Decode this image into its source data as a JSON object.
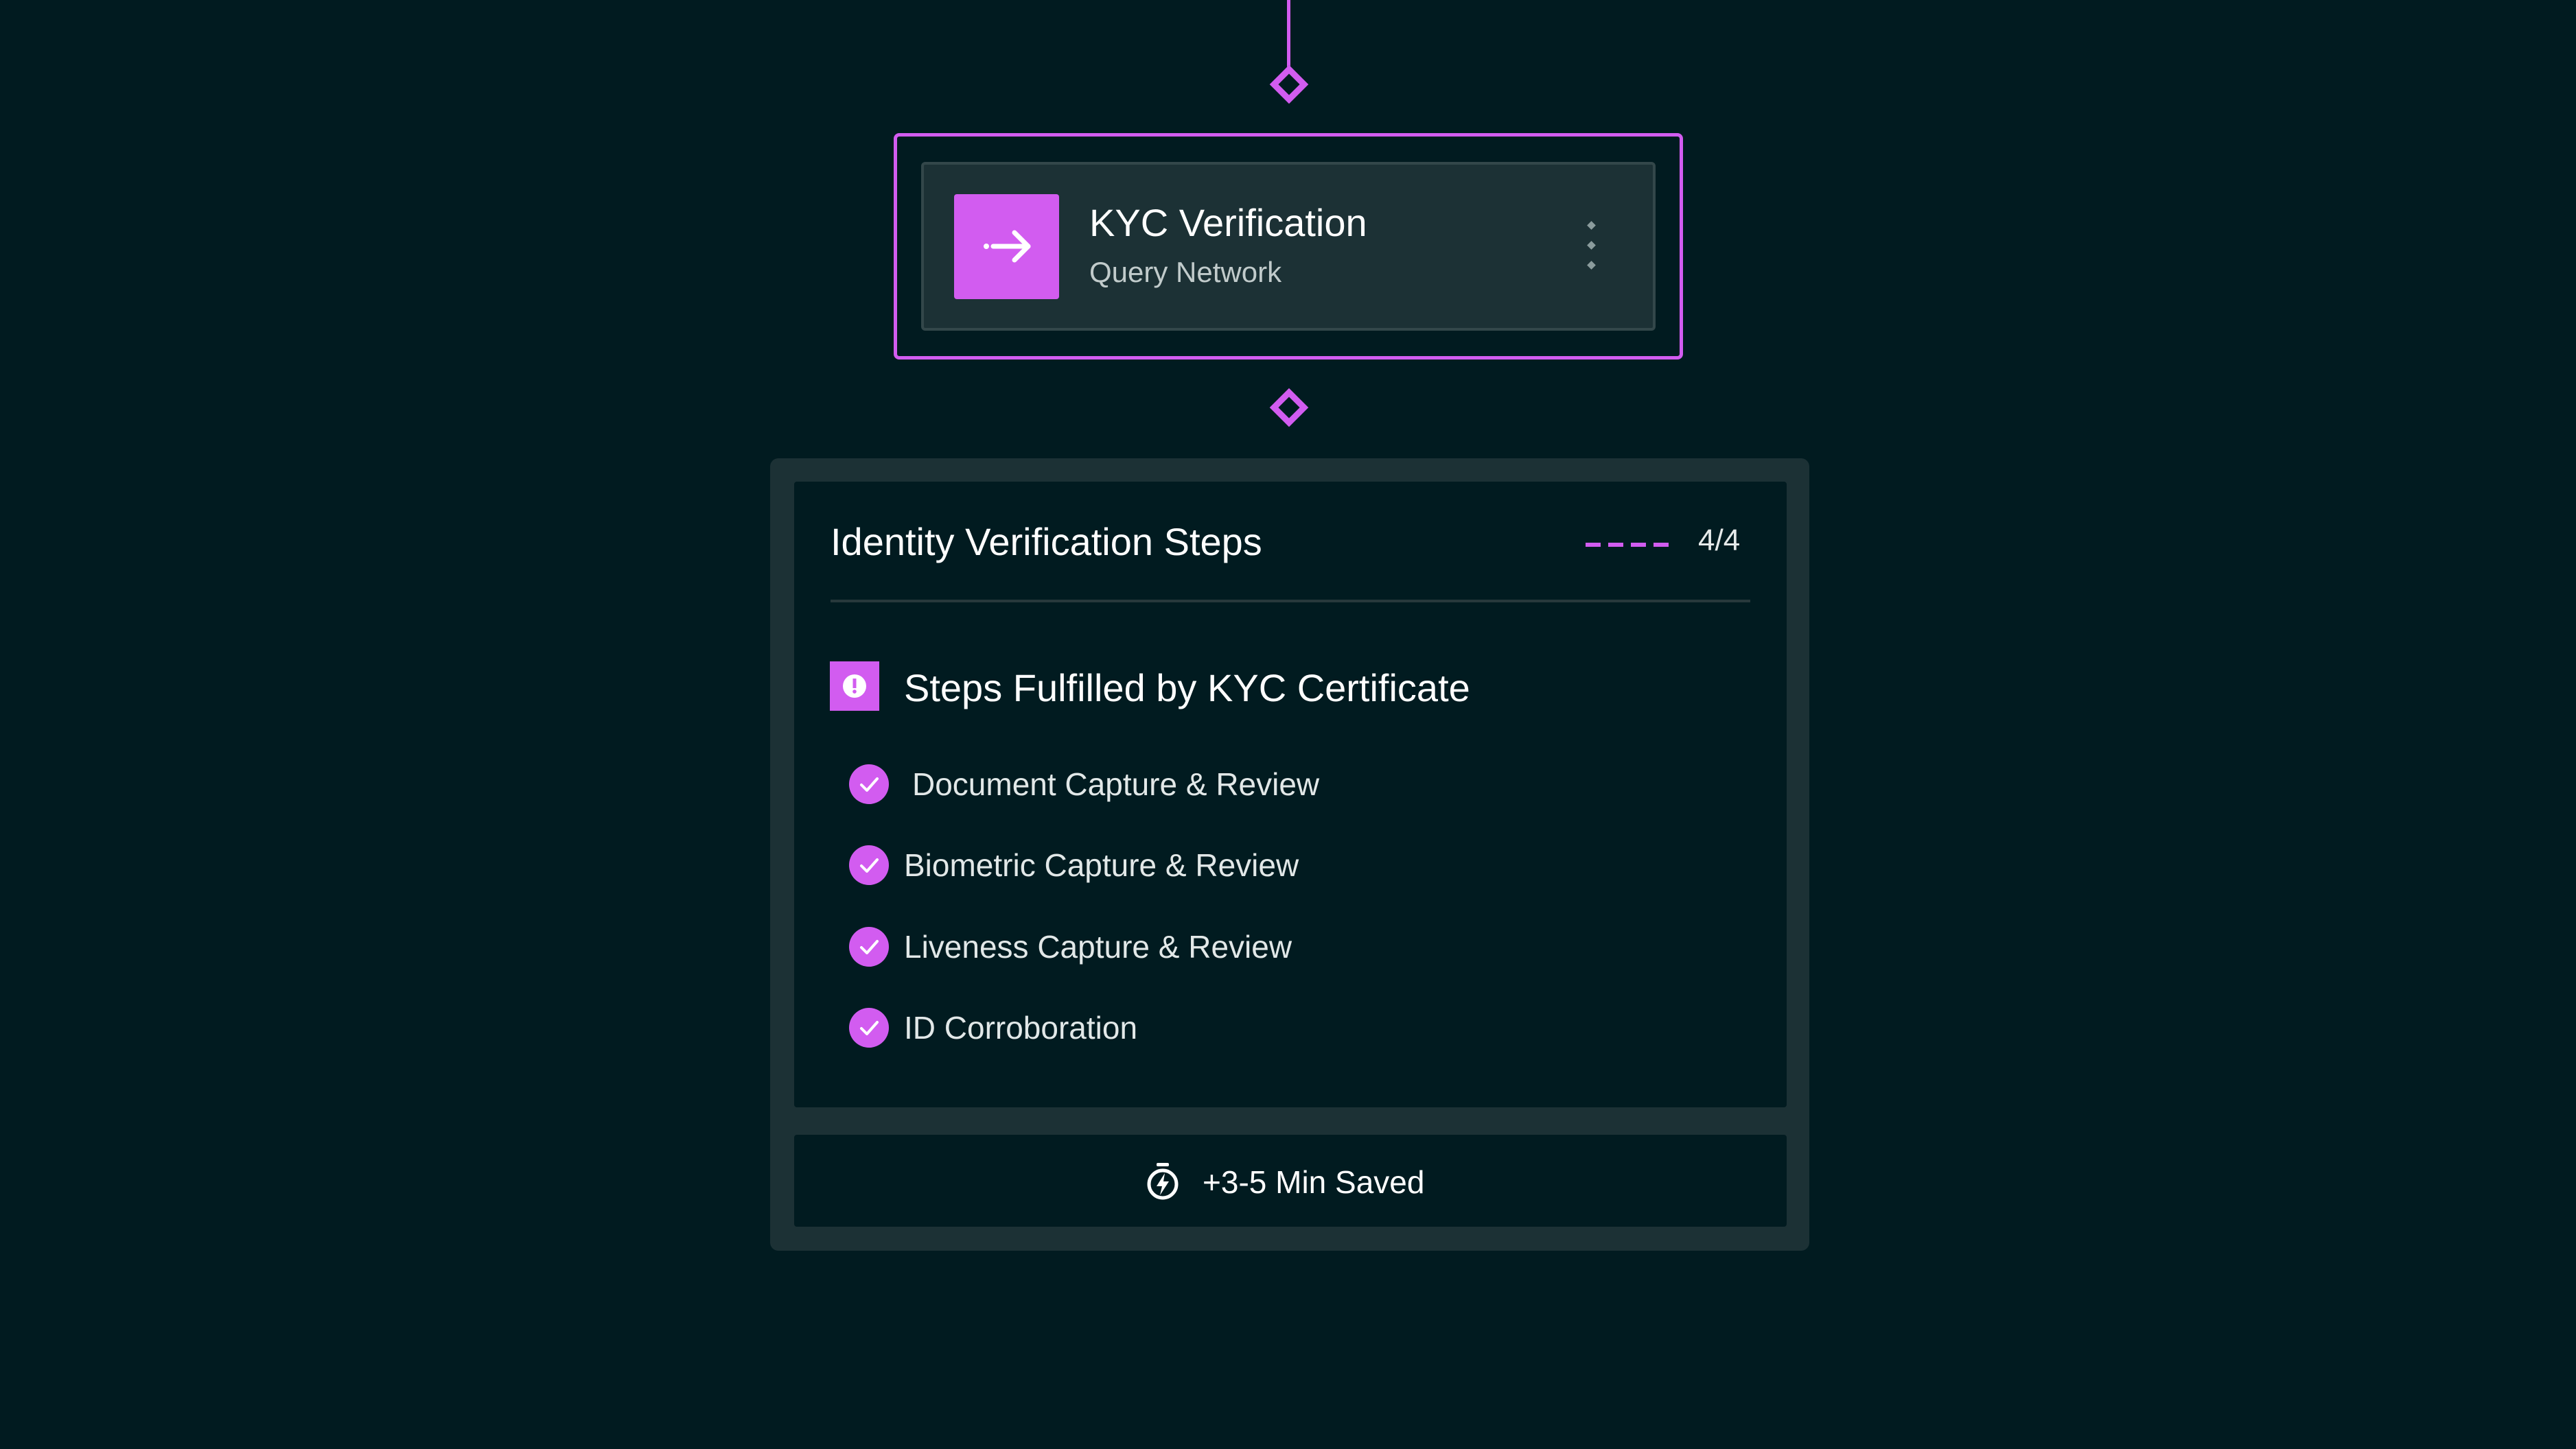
{
  "colors": {
    "background": "#011b20",
    "accent": "#d25cf0",
    "panel": "#1c3135",
    "text_primary": "#ffffff",
    "text_secondary": "#c1cbcb"
  },
  "node": {
    "title": "KYC Verification",
    "subtitle": "Query Network",
    "icon": "arrow-right-icon",
    "menu_icon": "more-vertical-icon"
  },
  "panel": {
    "title": "Identity Verification Steps",
    "progress": "4/4",
    "progress_fraction": 1.0,
    "certificate": {
      "icon": "alert-icon",
      "title": "Steps Fulfilled by KYC Certificate"
    },
    "steps": [
      {
        "label": "Document Capture & Review",
        "status": "complete"
      },
      {
        "label": "Biometric Capture & Review",
        "status": "complete"
      },
      {
        "label": "Liveness Capture & Review",
        "status": "complete"
      },
      {
        "label": "ID Corroboration",
        "status": "complete"
      }
    ],
    "time_saved": {
      "icon": "stopwatch-icon",
      "label": "+3-5 Min Saved"
    }
  }
}
